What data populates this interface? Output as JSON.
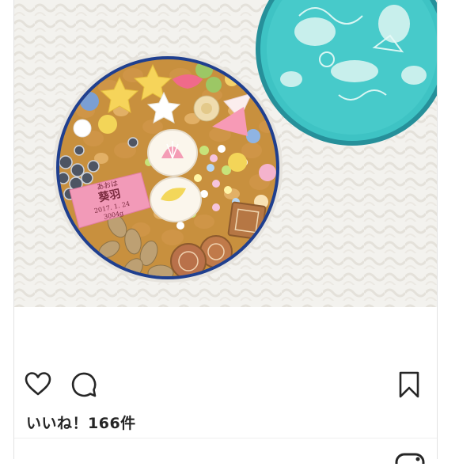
{
  "post": {
    "photo": {
      "name_card": {
        "kana": "あおは",
        "name": "葵羽",
        "date": "2017. 1. 24",
        "weight": "3004g"
      }
    },
    "actions": {
      "like_icon": "heart-outline-icon",
      "comment_icon": "comment-bubble-icon",
      "bookmark_icon": "bookmark-outline-icon"
    },
    "likes_text": "いいね！166件",
    "colors": {
      "text": "#262626",
      "tin_lid": "#3ec3c4",
      "tin_rim": "#1f3f8f"
    }
  }
}
